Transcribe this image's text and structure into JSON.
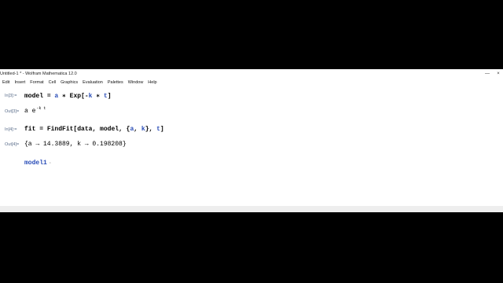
{
  "window": {
    "title": "Untitled-1 * - Wolfram Mathematica 12.0",
    "minimize_glyph": "—",
    "close_glyph": "×"
  },
  "menubar": {
    "items": [
      "Edit",
      "Insert",
      "Format",
      "Cell",
      "Graphics",
      "Evaluation",
      "Palettes",
      "Window",
      "Help"
    ]
  },
  "cells": [
    {
      "in_label": "In[3]:=",
      "input_parts": [
        "model",
        " = ",
        "a",
        " ∗ ",
        "Exp",
        "[-",
        "k",
        " ∗ ",
        "t",
        "]"
      ],
      "out_label": "Out[3]=",
      "output_base": "a e",
      "output_sup": "-k t"
    },
    {
      "in_label": "In[4]:=",
      "input_parts": [
        "fit",
        " = ",
        "FindFit",
        "[",
        "data",
        ", ",
        "model",
        ", {",
        "a",
        ", ",
        "k",
        "}, ",
        "t",
        "]"
      ],
      "out_label": "Out[4]=",
      "output_text": "{a → 14.3889, k → 0.198208}"
    },
    {
      "input_text": "model1",
      "cursor_glyph": "▫"
    }
  ],
  "colors": {
    "background": "#000000",
    "label": "#5a6d8a",
    "symbol_blue": "#2a4db8"
  }
}
